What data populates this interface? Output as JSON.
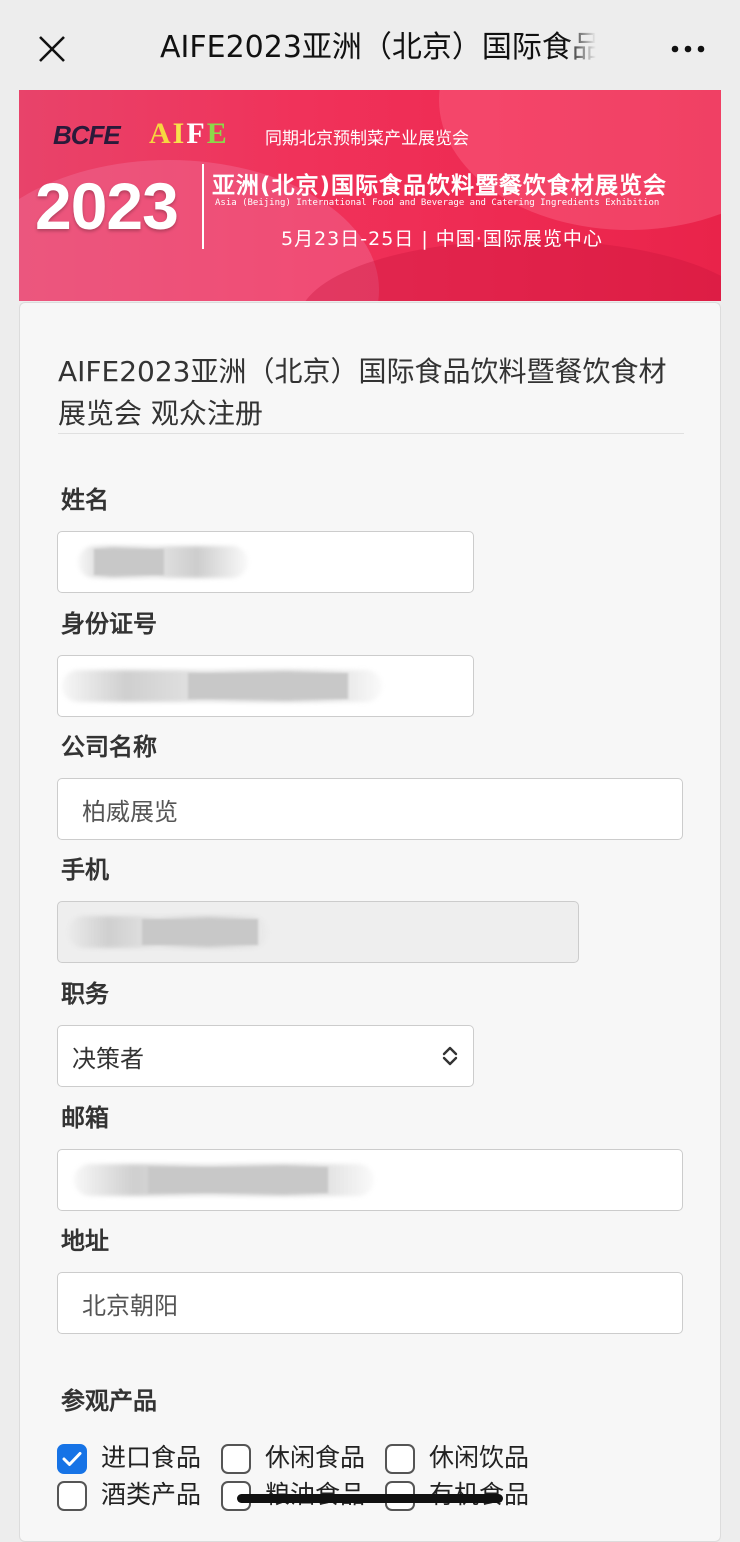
{
  "nav": {
    "title": "AIFE2023亚洲（北京）国际食品",
    "close_icon": "close-icon",
    "more_icon": "more-horizontal-icon"
  },
  "banner": {
    "logo_bcfe": "BCFE",
    "logo_aife": [
      "A",
      "I",
      "F",
      "E"
    ],
    "subtitle": "同期北京预制菜产业展览会",
    "year": "2023",
    "main_title": "亚洲(北京)国际食品饮料暨餐饮食材展览会",
    "english_title": "Asia (Beijing) International Food and Beverage and Catering Ingredients Exhibition",
    "date_venue": "5月23日-25日 | 中国·国际展览中心",
    "colors": {
      "primary": "#ee2a52",
      "accent": "#f6d640"
    }
  },
  "form": {
    "title": "AIFE2023亚洲（北京）国际食品饮料暨餐饮食材展览会 观众注册",
    "fields": {
      "name": {
        "label": "姓名",
        "value": ""
      },
      "id_number": {
        "label": "身份证号",
        "value": ""
      },
      "company": {
        "label": "公司名称",
        "value": "柏威展览"
      },
      "phone": {
        "label": "手机",
        "value": ""
      },
      "position": {
        "label": "职务",
        "value": "决策者"
      },
      "email": {
        "label": "邮箱",
        "value": ""
      },
      "address": {
        "label": "地址",
        "value": "北京朝阳"
      }
    },
    "products": {
      "label": "参观产品",
      "items": [
        {
          "label": "进口食品",
          "checked": true
        },
        {
          "label": "休闲食品",
          "checked": false
        },
        {
          "label": "休闲饮品",
          "checked": false
        },
        {
          "label": "酒类产品",
          "checked": false
        },
        {
          "label": "粮油食品",
          "checked": false
        },
        {
          "label": "有机食品",
          "checked": false
        }
      ]
    }
  }
}
